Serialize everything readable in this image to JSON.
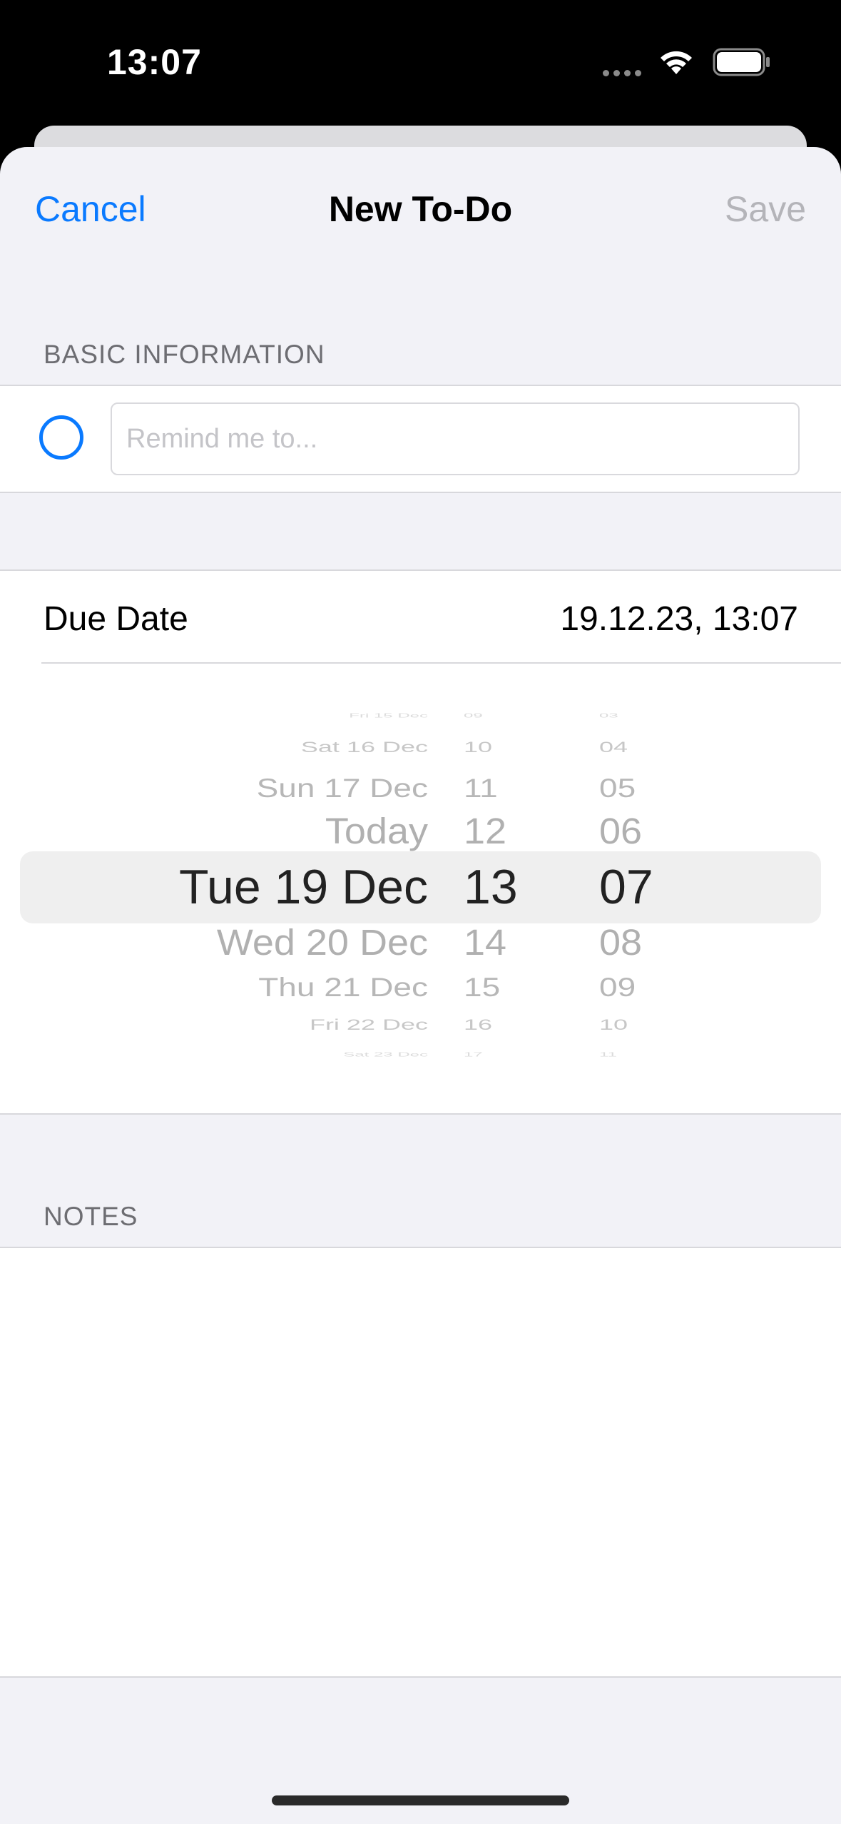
{
  "status_bar": {
    "time": "13:07"
  },
  "nav": {
    "cancel_label": "Cancel",
    "title": "New To-Do",
    "save_label": "Save"
  },
  "basic_info": {
    "header": "BASIC INFORMATION",
    "placeholder": "Remind me to..."
  },
  "due_date": {
    "label": "Due Date",
    "value": "19.12.23, 13:07"
  },
  "picker": {
    "days": [
      "Fri 15 Dec",
      "Sat 16 Dec",
      "Sun 17 Dec",
      "Today",
      "Tue 19 Dec",
      "Wed 20 Dec",
      "Thu 21 Dec",
      "Fri 22 Dec",
      "Sat 23 Dec"
    ],
    "hours": [
      "09",
      "10",
      "11",
      "12",
      "13",
      "14",
      "15",
      "16",
      "17"
    ],
    "minutes": [
      "03",
      "04",
      "05",
      "06",
      "07",
      "08",
      "09",
      "10",
      "11"
    ],
    "selected_day": "Tue 19 Dec",
    "selected_hour": "13",
    "selected_minute": "07"
  },
  "notes": {
    "header": "NOTES"
  },
  "colors": {
    "accent": "#0a7aff",
    "disabled": "#b4b4b9",
    "background": "#f2f2f7"
  }
}
